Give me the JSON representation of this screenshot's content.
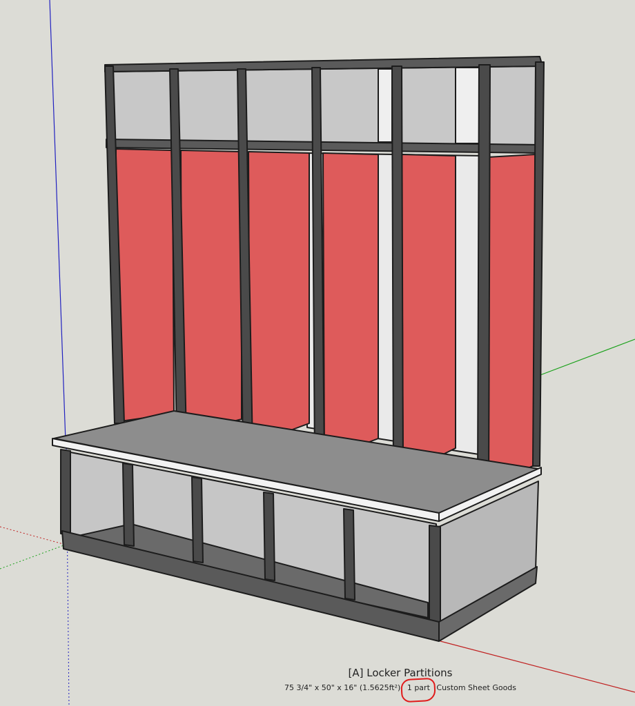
{
  "app": {
    "canvas_background": "#dcdcd6"
  },
  "model": {
    "name": "locker-bench",
    "colors": {
      "frame_dark": "#4a4a4a",
      "frame_edge": "#1c1c1c",
      "partition_red": "#de5b5b",
      "cubby_gray": "#c6c6c6",
      "back_light": "#e8e8e8",
      "seat_gray": "#8d8d8d",
      "seat_edge_white": "#f2f2f2",
      "side_panel": "#b8b8b8"
    },
    "axes": {
      "blue": "#2020c0",
      "green": "#18a018",
      "red": "#c02020"
    }
  },
  "selection": {
    "title": "[A] Locker Partitions",
    "dimensions": "75 3/4\" x 50\" x 16\" (1.5625ft²)",
    "count": "1 part",
    "material": "Custom Sheet Goods",
    "highlight_color": "#e01b1b"
  }
}
